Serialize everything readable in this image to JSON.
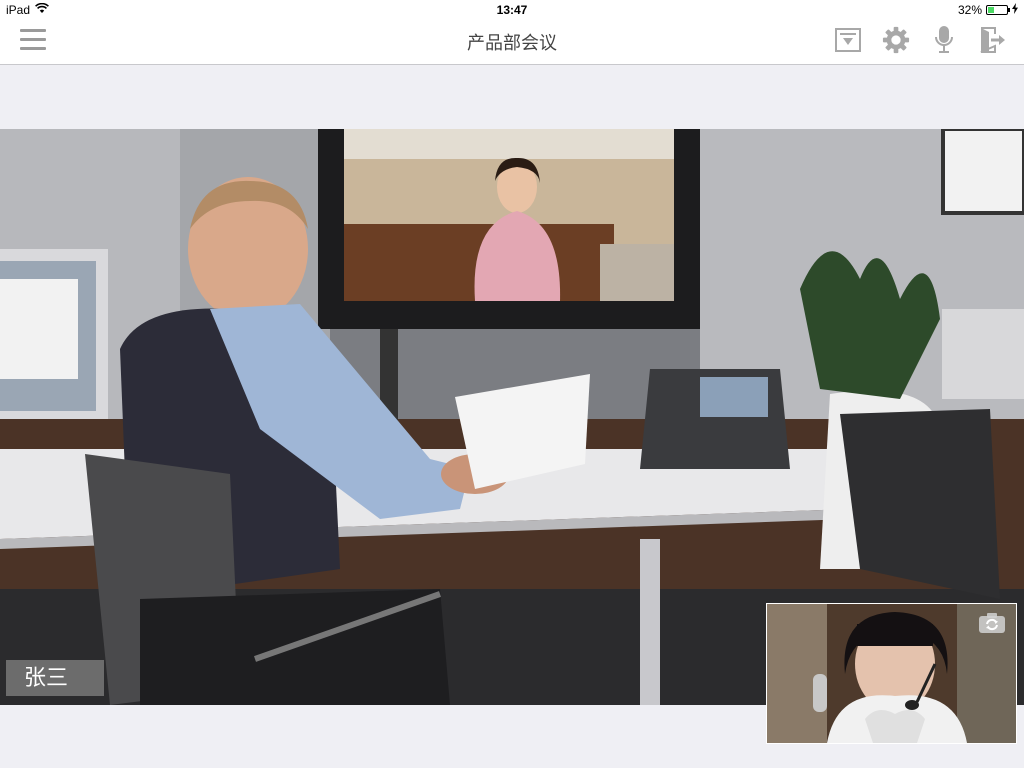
{
  "status_bar": {
    "device": "iPad",
    "time": "13:47",
    "battery": "32%",
    "battery_level": 0.32
  },
  "header": {
    "title": "产品部会议"
  },
  "icons": {
    "menu": "menu-icon",
    "actions": [
      "dropdown-icon",
      "gear-icon",
      "microphone-icon",
      "exit-icon"
    ]
  },
  "main_video": {
    "participant_name": "张三"
  },
  "self_view": {
    "camera_switch": "camera-switch-icon"
  },
  "colors": {
    "background": "#efeff4",
    "toolbar_icon": "#a8a8a8",
    "battery_fill": "#4cd964"
  }
}
